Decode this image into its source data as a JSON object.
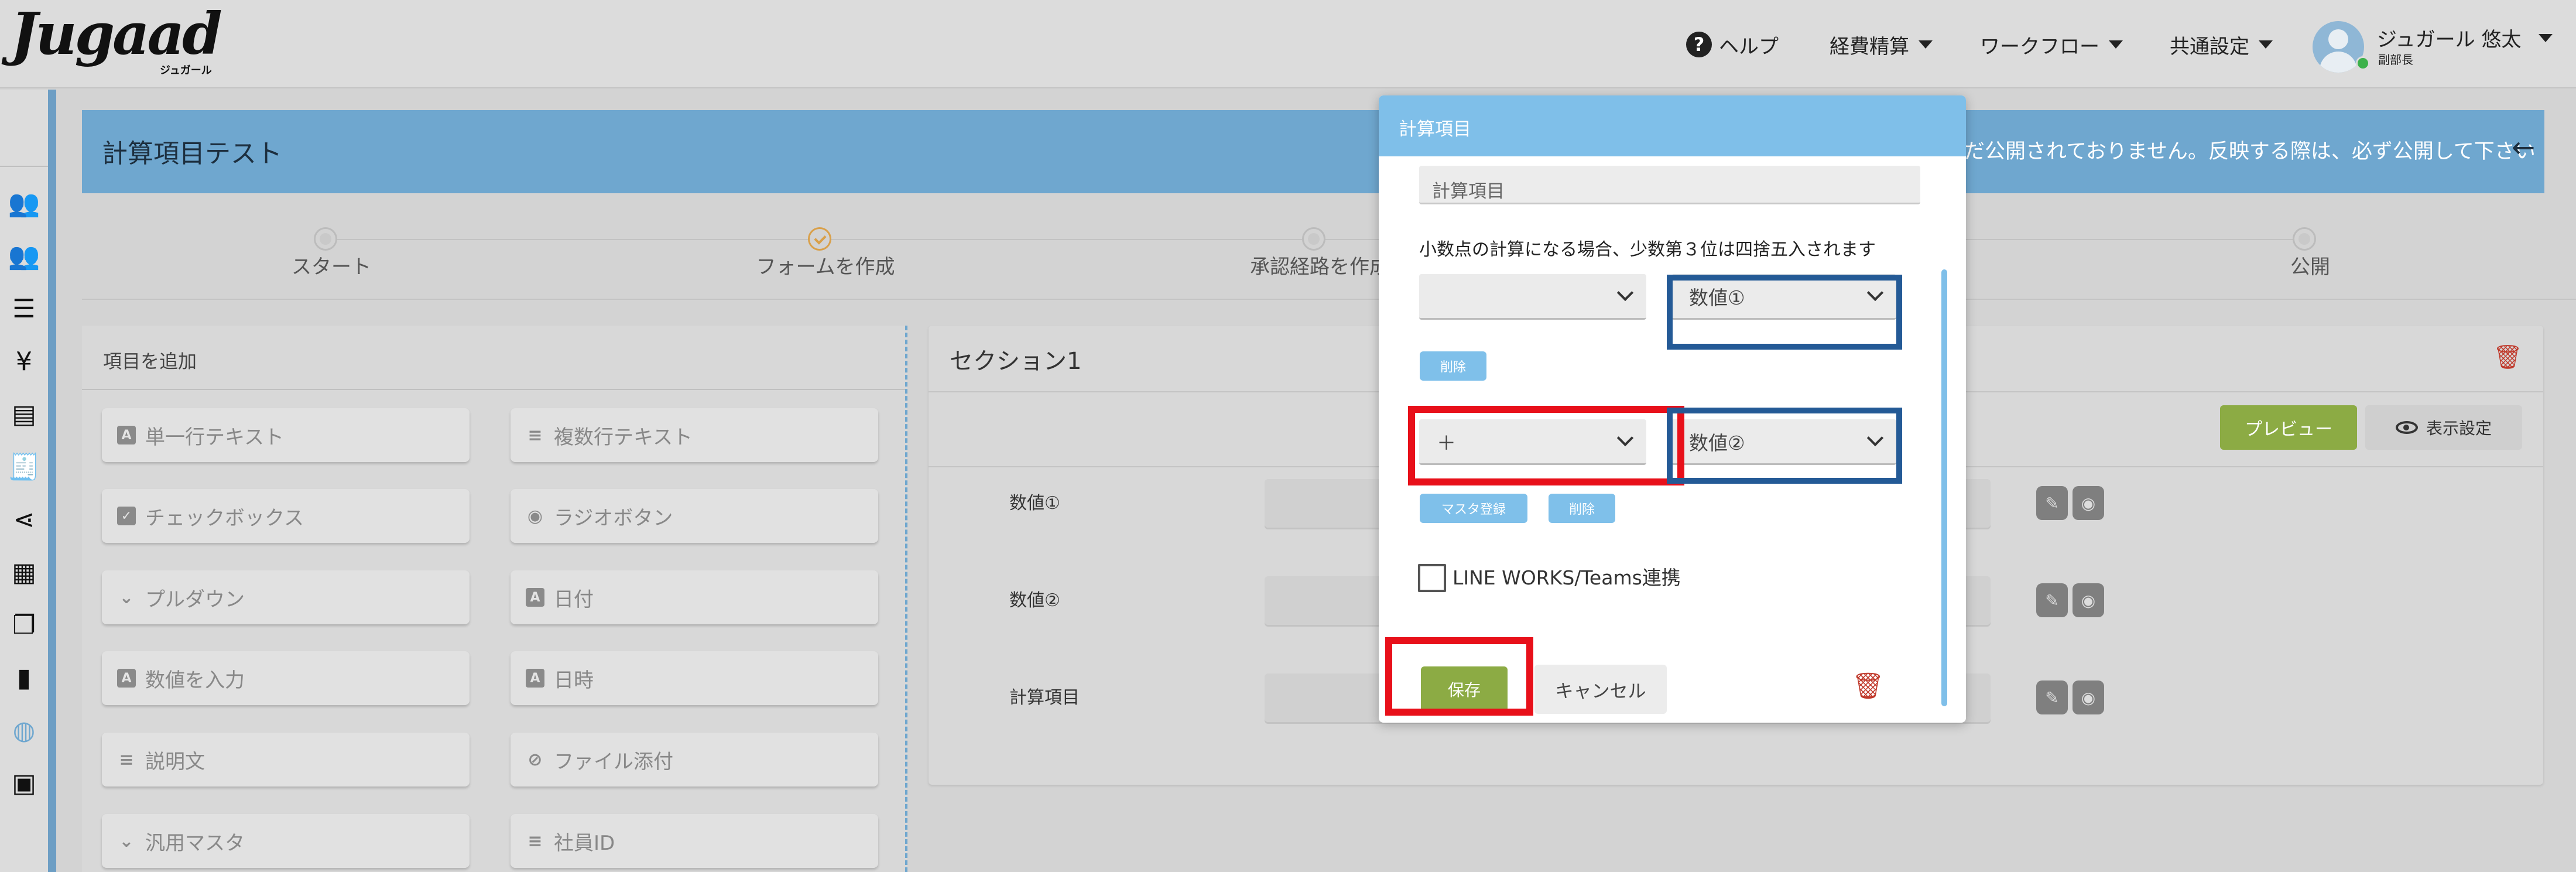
{
  "header": {
    "logo": "Jugaad",
    "logo_sub": "ジュガール",
    "nav": [
      {
        "label": "ヘルプ",
        "icon": "help-icon"
      },
      {
        "label": "経費精算"
      },
      {
        "label": "ワークフロー"
      },
      {
        "label": "共通設定"
      }
    ],
    "user": {
      "name": "ジュガール 悠太",
      "role": "副部長",
      "status_color": "#3cb14a"
    }
  },
  "page": {
    "title": "計算項目テスト",
    "notice": "だ公開されておりません。反映する際は、必ず公開して下さい",
    "steps": [
      "スタート",
      "フォームを作成",
      "承認経路を作成",
      "公開"
    ],
    "active_step": 1
  },
  "add_panel": {
    "header": "項目を追加",
    "fields": [
      {
        "label": "単一行テキスト",
        "icon": "A"
      },
      {
        "label": "複数行テキスト",
        "icon": "≡"
      },
      {
        "label": "チェックボックス",
        "icon": "✓"
      },
      {
        "label": "ラジオボタン",
        "icon": "◉"
      },
      {
        "label": "プルダウン",
        "icon": "⌄"
      },
      {
        "label": "日付",
        "icon": "A"
      },
      {
        "label": "数値を入力",
        "icon": "A"
      },
      {
        "label": "日時",
        "icon": "A"
      },
      {
        "label": "説明文",
        "icon": "≡"
      },
      {
        "label": "ファイル添付",
        "icon": "⊘"
      },
      {
        "label": "汎用マスタ",
        "icon": "⌄"
      },
      {
        "label": "社員ID",
        "icon": "≡"
      }
    ]
  },
  "section": {
    "title": "セクション1",
    "preview_label": "プレビュー",
    "display_label": "表示設定",
    "rows": [
      {
        "label": "数値①"
      },
      {
        "label": "数値②"
      },
      {
        "label": "計算項目"
      }
    ]
  },
  "modal": {
    "title": "計算項目",
    "name_value": "計算項目",
    "note": "小数点の計算になる場合、少数第３位は四捨五入されます",
    "row1": {
      "operator": "",
      "operand": "数値①",
      "delete_label": "削除"
    },
    "row2": {
      "operator": "＋",
      "operand": "数値②",
      "master_label": "マスタ登録",
      "delete_label": "削除"
    },
    "checkbox_label": "LINE WORKS/Teams連携",
    "save_label": "保存",
    "cancel_label": "キャンセル"
  },
  "colors": {
    "accent_blue": "#7fbfe9",
    "title_bar": "#6fa7cf",
    "save_green": "#8cab44",
    "highlight_red": "#e8101a",
    "highlight_blue": "#245a96"
  }
}
